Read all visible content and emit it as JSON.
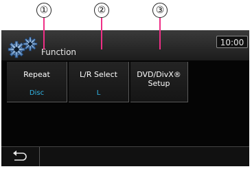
{
  "callouts": [
    {
      "number": "①"
    },
    {
      "number": "②"
    },
    {
      "number": "③"
    }
  ],
  "header": {
    "title": "Function",
    "clock": "10:00",
    "icon": "gear-icon"
  },
  "buttons": [
    {
      "label": "Repeat",
      "value": "Disc"
    },
    {
      "label": "L/R Select",
      "value": "L"
    },
    {
      "label": "DVD/DivX®\nSetup",
      "value": ""
    }
  ],
  "footer": {
    "back_icon": "back-arrow-icon"
  },
  "colors": {
    "value_text": "#31b6e7",
    "callout_line": "#ee2f86",
    "background": "#050505"
  }
}
